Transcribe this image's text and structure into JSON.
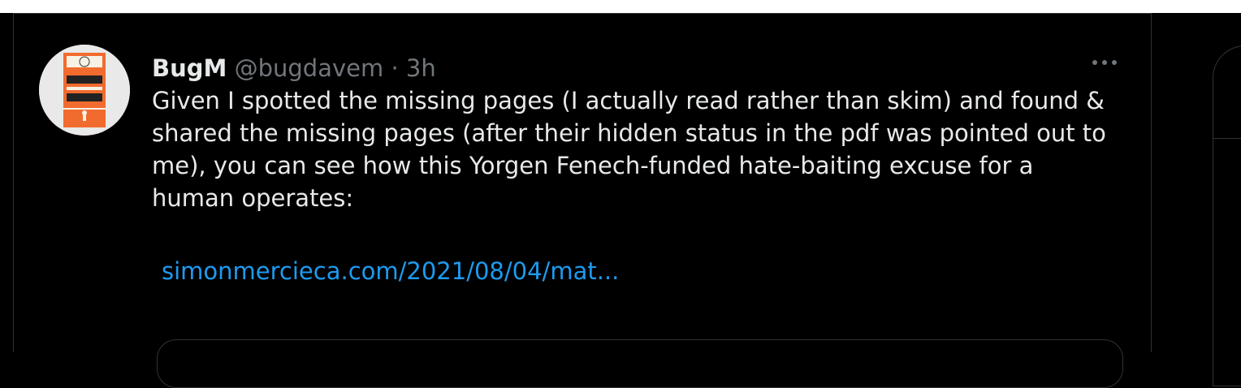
{
  "tweet": {
    "author_name": "BugM",
    "handle": "@bugdavem",
    "separator": "·",
    "time": "3h",
    "text": "Given I spotted the missing pages (I actually read rather than skim) and found & shared the missing pages (after their hidden status in the pdf was pointed out to me), you can see how this Yorgen Fenech-funded hate-baiting excuse for a human operates:",
    "link_text": "simonmercieca.com/2021/08/04/mat..."
  },
  "icons": {
    "more": "more-horizontal-icon"
  },
  "colors": {
    "background": "#000000",
    "text": "#e7e9ea",
    "muted": "#71767b",
    "link": "#1d9bf0",
    "border": "#2f3336"
  }
}
